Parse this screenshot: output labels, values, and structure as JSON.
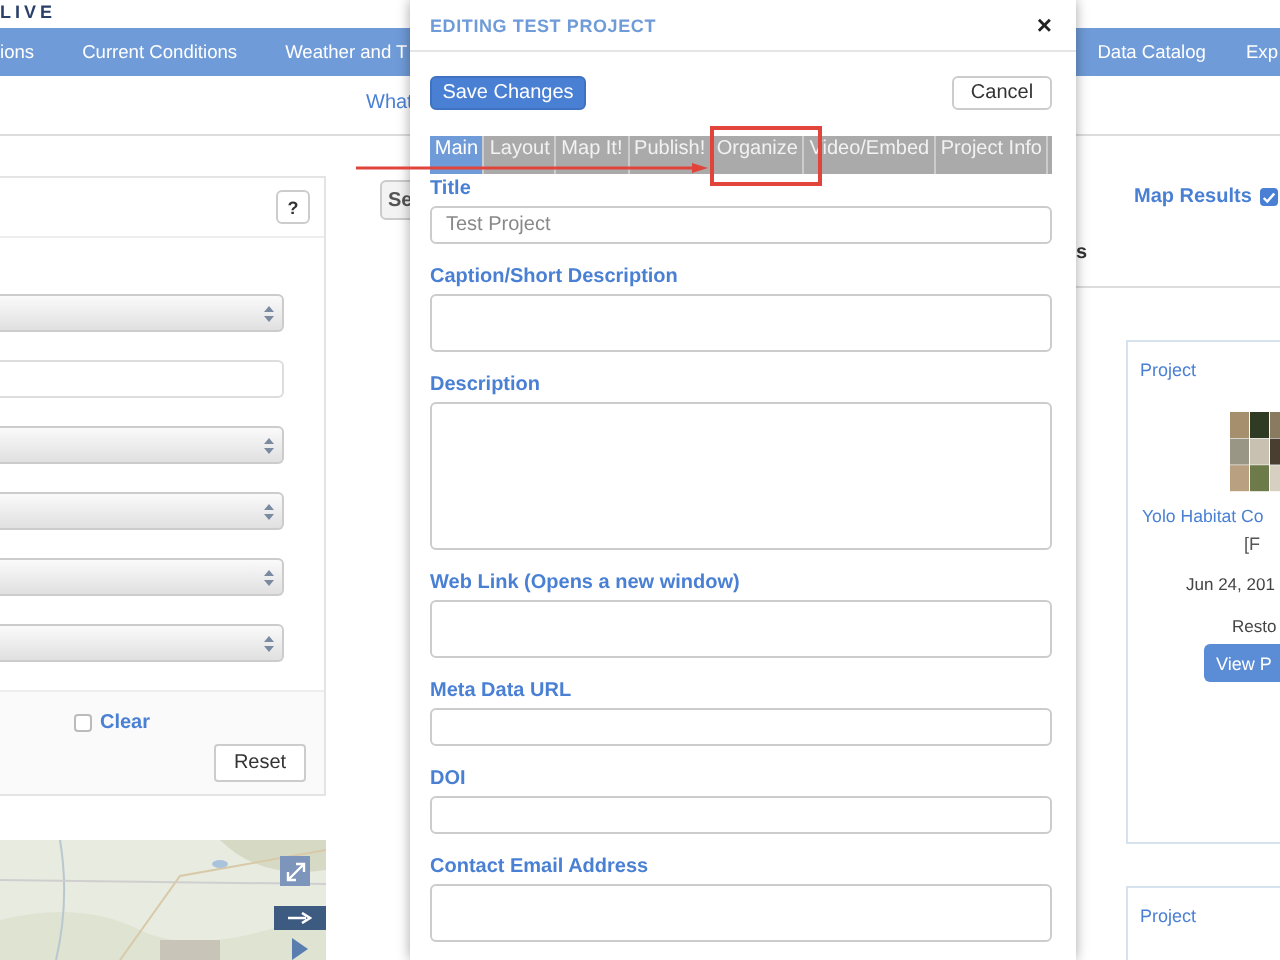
{
  "logo": {
    "text": "LIVE"
  },
  "nav": {
    "left_items": [
      {
        "label": "ions"
      },
      {
        "label": "Current Conditions"
      },
      {
        "label": "Weather and T"
      }
    ],
    "right_items": [
      {
        "label": "Data Catalog"
      },
      {
        "label": "Exp"
      }
    ]
  },
  "subnav": {
    "tab": "What"
  },
  "filters": {
    "help": "?",
    "fields": [
      {
        "kind": "select"
      },
      {
        "kind": "text"
      },
      {
        "kind": "select"
      },
      {
        "kind": "select"
      },
      {
        "kind": "select"
      },
      {
        "kind": "select"
      }
    ],
    "clear": {
      "label": "Clear",
      "checked": false
    },
    "reset": "Reset"
  },
  "search_button": "Se",
  "results": {
    "map_results": {
      "label": "Map Results",
      "checked": true
    },
    "heading_fragment": "s",
    "cards": [
      {
        "type": "Project",
        "title": "Yolo Habitat Co",
        "tag": "[F",
        "date": "Jun 24, 201",
        "category": "Resto",
        "button": "View P"
      },
      {
        "type": "Project"
      }
    ]
  },
  "modal": {
    "title": "EDITING TEST PROJECT",
    "close": "×",
    "save": "Save Changes",
    "cancel": "Cancel",
    "tabs": [
      {
        "label": "Main",
        "selected": true
      },
      {
        "label": "Layout",
        "selected": false
      },
      {
        "label": "Map It!",
        "selected": false
      },
      {
        "label": "Publish!",
        "selected": false
      },
      {
        "label": "Organize",
        "selected": false
      },
      {
        "label": "Video/Embed",
        "selected": false
      },
      {
        "label": "Project Info",
        "selected": false
      }
    ],
    "fields": [
      {
        "label": "Title",
        "kind": "input",
        "value": "Test Project"
      },
      {
        "label": "Caption/Short Description",
        "kind": "textarea"
      },
      {
        "label": "Description",
        "kind": "large-textarea"
      },
      {
        "label": "Web Link (Opens a new window)",
        "kind": "textarea"
      },
      {
        "label": "Meta Data URL",
        "kind": "input"
      },
      {
        "label": "DOI",
        "kind": "input"
      },
      {
        "label": "Contact Email Address",
        "kind": "textarea"
      }
    ]
  }
}
